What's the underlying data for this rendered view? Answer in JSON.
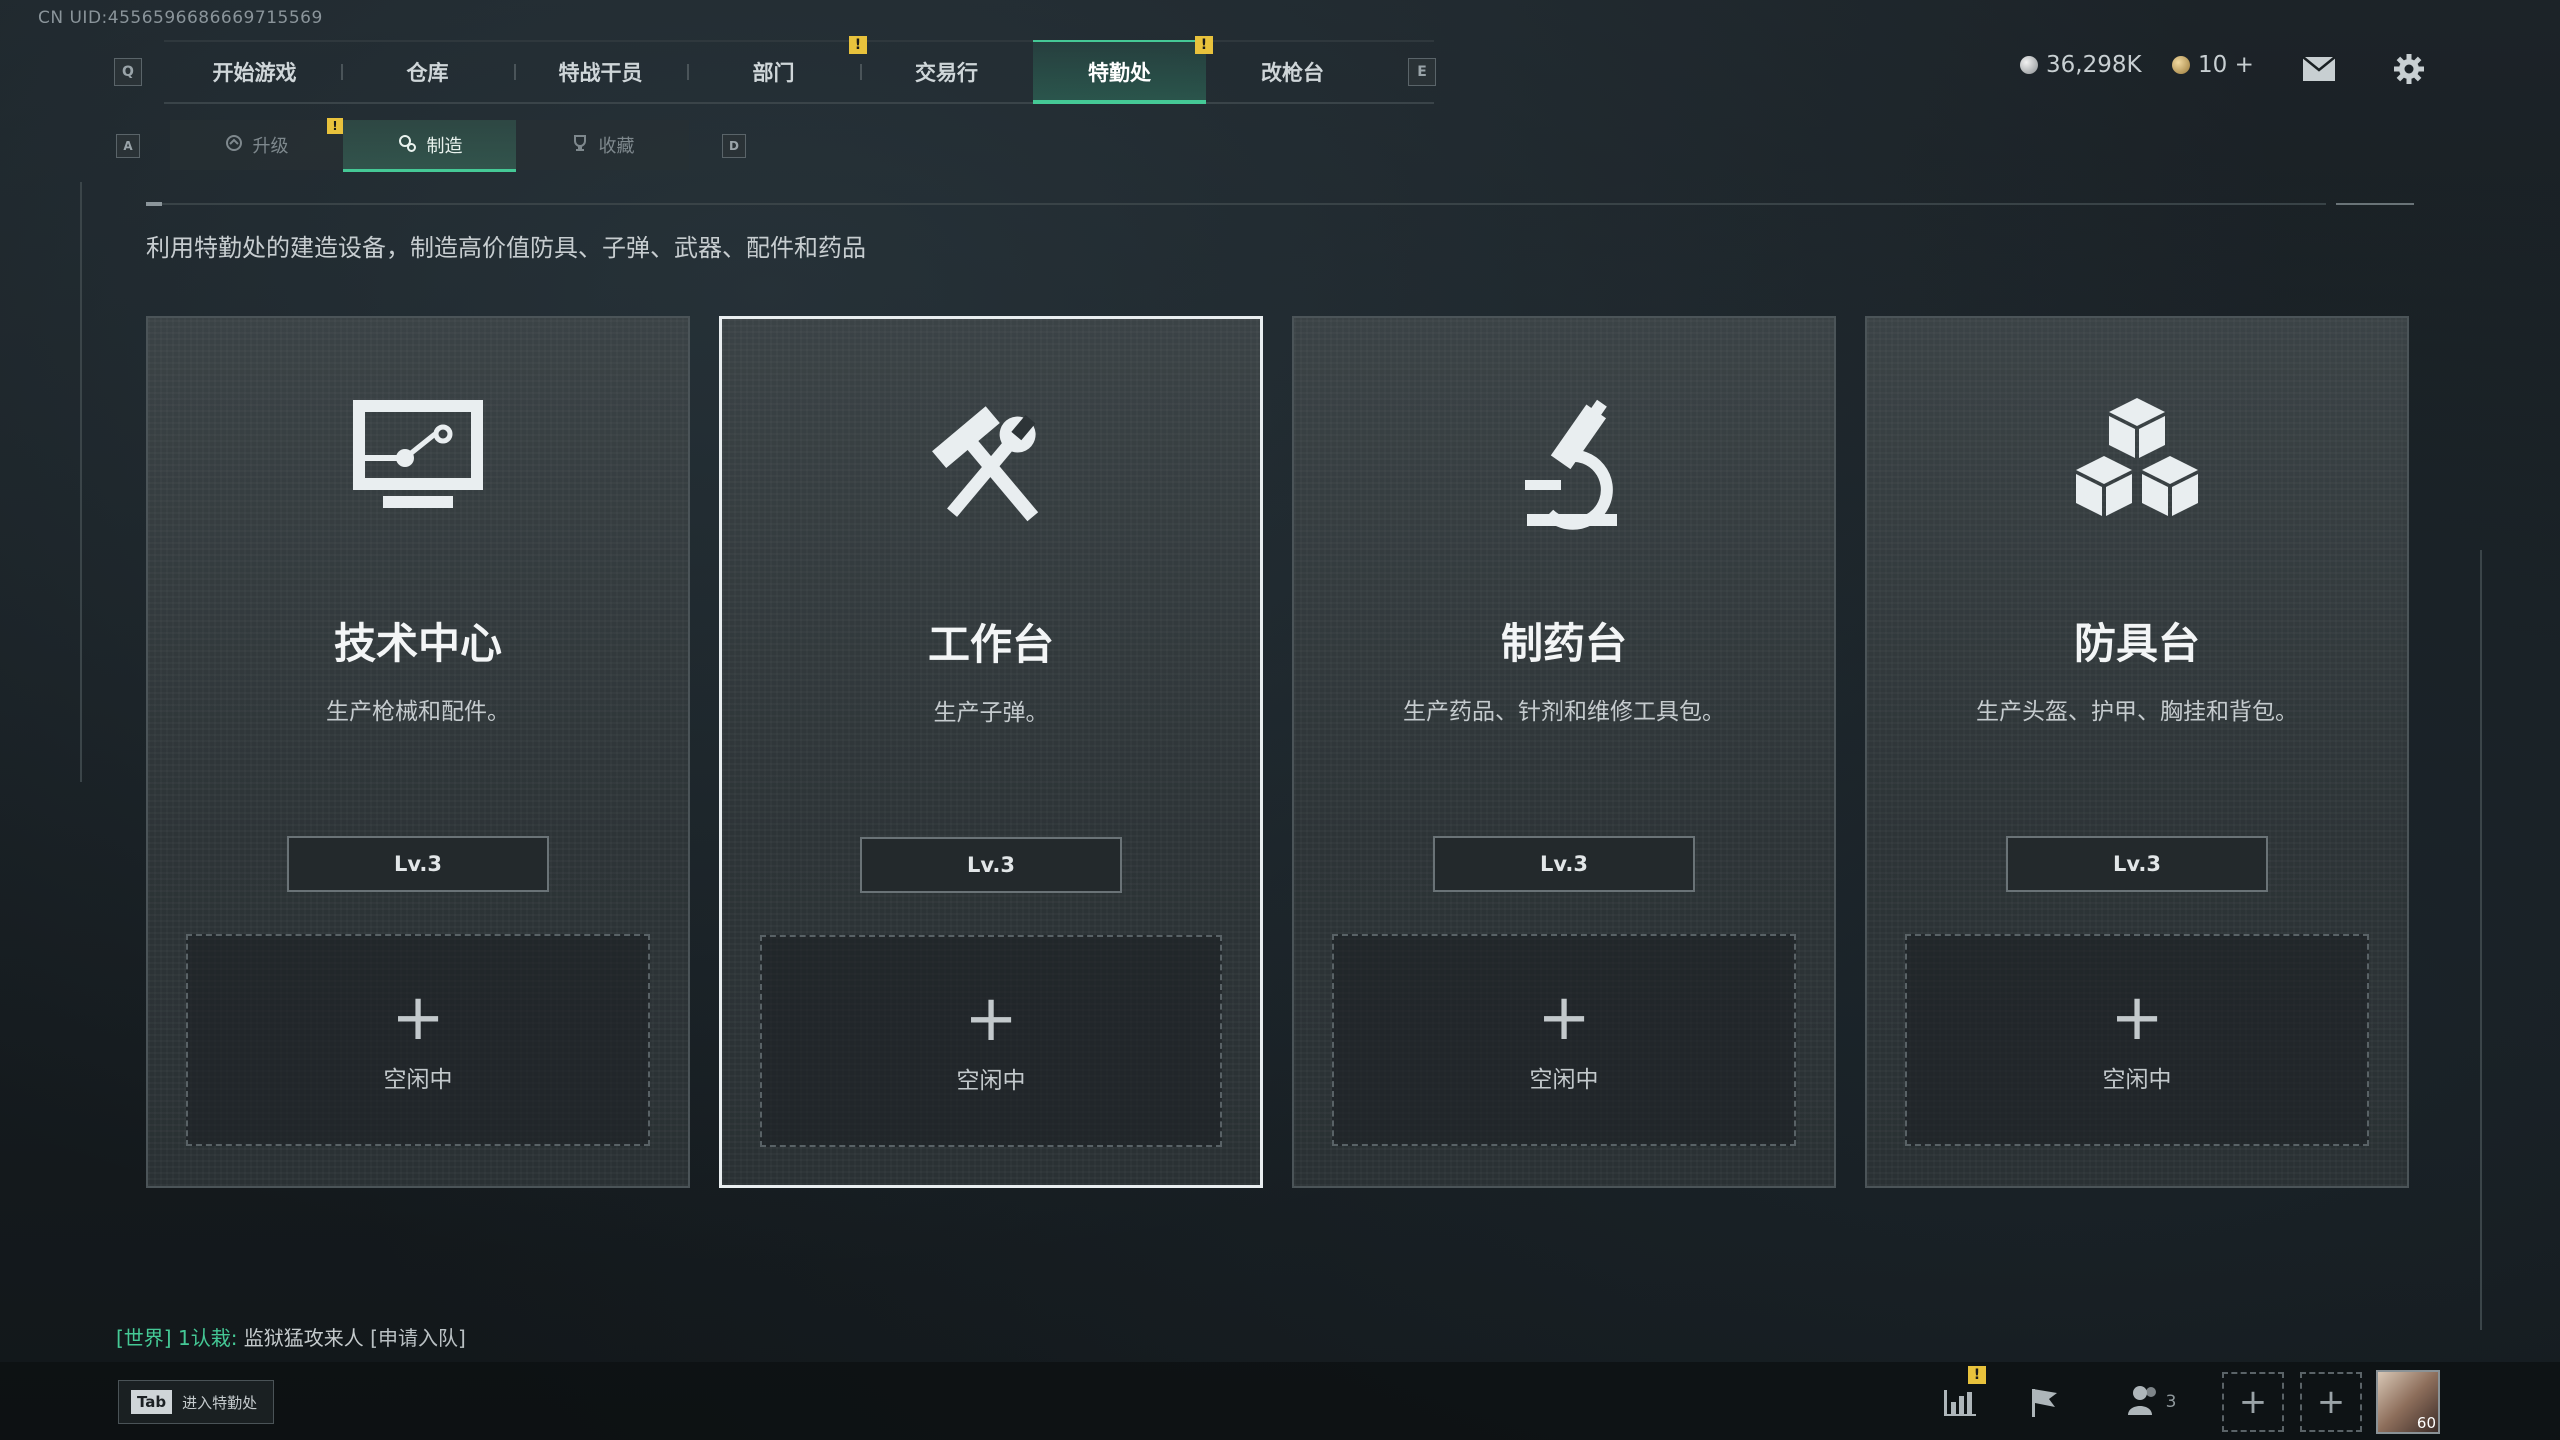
{
  "uid_text": "CN UID:4556596686669715569",
  "nav": {
    "key_left": "Q",
    "key_right": "E",
    "tabs": [
      {
        "label": "开始游戏"
      },
      {
        "label": "仓库"
      },
      {
        "label": "特战干员"
      },
      {
        "label": "部门",
        "badge": "!"
      },
      {
        "label": "交易行"
      },
      {
        "label": "特勤处",
        "badge": "!"
      },
      {
        "label": "改枪台"
      }
    ],
    "active_tab": "特勤处"
  },
  "currency": {
    "silver": "36,298K",
    "gold": "10 +"
  },
  "top_icons": [
    "mail-icon",
    "gear-icon"
  ],
  "subnav": {
    "key_left": "A",
    "key_right": "D",
    "tabs": [
      {
        "label": "升级",
        "icon": "upgrade-icon",
        "badge": "!"
      },
      {
        "label": "制造",
        "icon": "craft-gear-icon"
      },
      {
        "label": "收藏",
        "icon": "trophy-icon"
      }
    ],
    "active_tab": "制造"
  },
  "description": "利用特勤处的建造设备，制造高价值防具、子弹、武器、配件和药品",
  "stations": [
    {
      "title": "技术中心",
      "subtitle": "生产枪械和配件。",
      "level": "Lv.3",
      "slot_plus": "+",
      "slot_label": "空闲中",
      "icon": "computer-icon"
    },
    {
      "title": "工作台",
      "subtitle": "生产子弹。",
      "level": "Lv.3",
      "slot_plus": "+",
      "slot_label": "空闲中",
      "icon": "hammer-wrench-icon"
    },
    {
      "title": "制药台",
      "subtitle": "生产药品、针剂和维修工具包。",
      "level": "Lv.3",
      "slot_plus": "+",
      "slot_label": "空闲中",
      "icon": "microscope-icon"
    },
    {
      "title": "防具台",
      "subtitle": "生产头盔、护甲、胸挂和背包。",
      "level": "Lv.3",
      "slot_plus": "+",
      "slot_label": "空闲中",
      "icon": "cubes-icon"
    }
  ],
  "selected_station": "工作台",
  "chat": {
    "channel": "[世界]",
    "sender": "1认栽:",
    "message": "监狱猛攻来人",
    "action": "[申请入队]"
  },
  "bottom": {
    "tab_key": "Tab",
    "tab_hint": "进入特勤处",
    "party_count": "3",
    "stats_badge": "!",
    "plus": "+",
    "avatar_level": "60"
  },
  "colors": {
    "accent": "#45c996",
    "badge": "#e8c23c"
  }
}
